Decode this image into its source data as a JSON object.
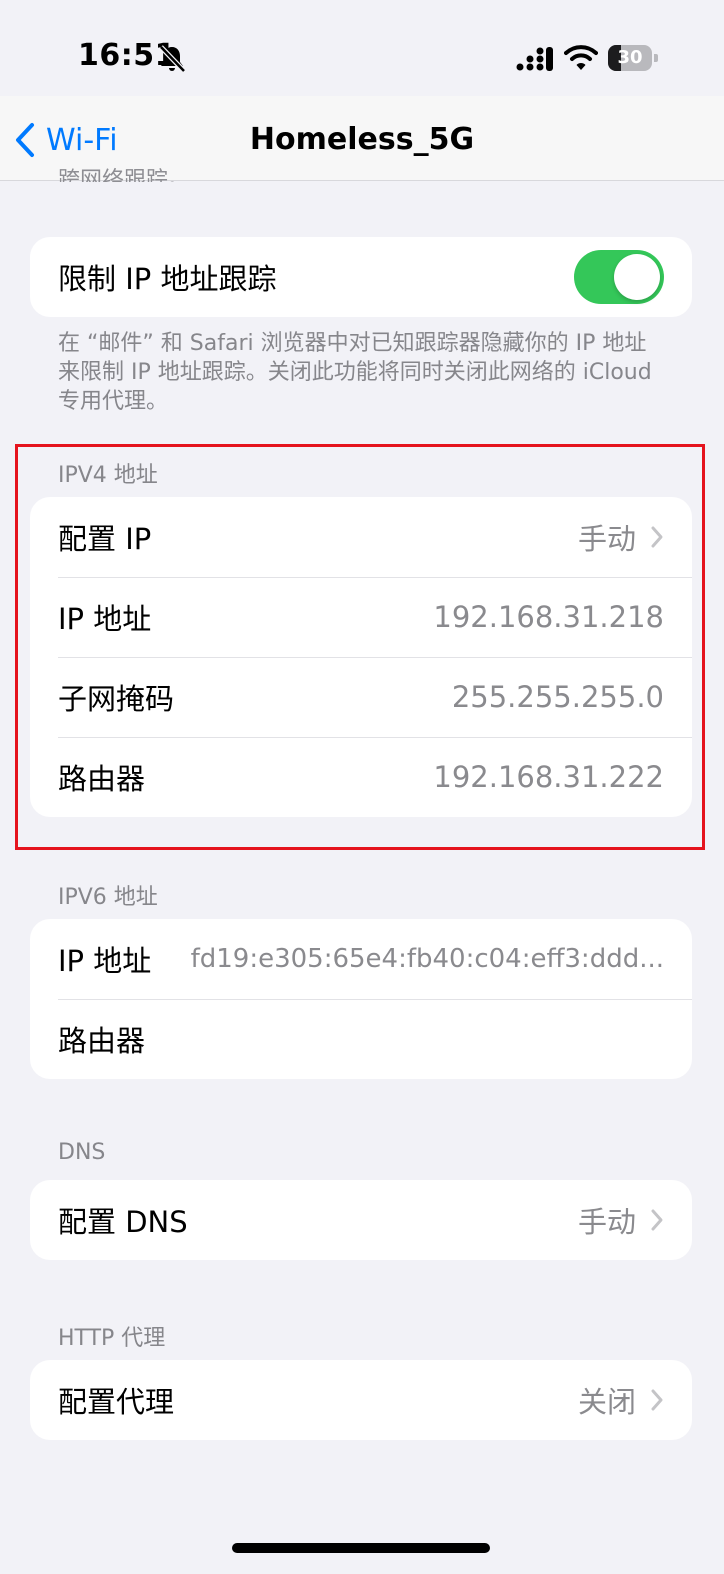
{
  "status_bar": {
    "time": "16:51",
    "battery_percent": "30",
    "battery_level": 0.3,
    "icons": [
      "bell-slash-icon",
      "cellular-signal-icon",
      "wifi-icon",
      "battery-icon"
    ]
  },
  "nav": {
    "back_label": "Wi-Fi",
    "title": "Homeless_5G",
    "scrolled_text": "跨网络跟踪。"
  },
  "privacy": {
    "limit_ip_label": "限制 IP 地址跟踪",
    "limit_ip_enabled": true,
    "footnote": "在 “邮件” 和 Safari 浏览器中对已知跟踪器隐藏你的 IP 地址来限制 IP 地址跟踪。关闭此功能将同时关闭此网络的 iCloud 专用代理。"
  },
  "ipv4": {
    "header": "IPV4 地址",
    "rows": [
      {
        "label": "配置 IP",
        "value": "手动"
      },
      {
        "label": "IP 地址",
        "value": "192.168.31.218"
      },
      {
        "label": "子网掩码",
        "value": "255.255.255.0"
      },
      {
        "label": "路由器",
        "value": "192.168.31.222"
      }
    ]
  },
  "ipv6": {
    "header": "IPV6 地址",
    "rows": [
      {
        "label": "IP 地址",
        "value": "fd19:e305:65e4:fb40:c04:eff3:ddd..."
      },
      {
        "label": "路由器",
        "value": ""
      }
    ]
  },
  "dns": {
    "header": "DNS",
    "configure_label": "配置 DNS",
    "configure_value": "手动"
  },
  "proxy": {
    "header": "HTTP 代理",
    "configure_label": "配置代理",
    "configure_value": "关闭"
  },
  "colors": {
    "accent": "#007aff",
    "toggle_on": "#34c759",
    "highlight_border": "#e5141e",
    "background": "#f2f2f7"
  }
}
